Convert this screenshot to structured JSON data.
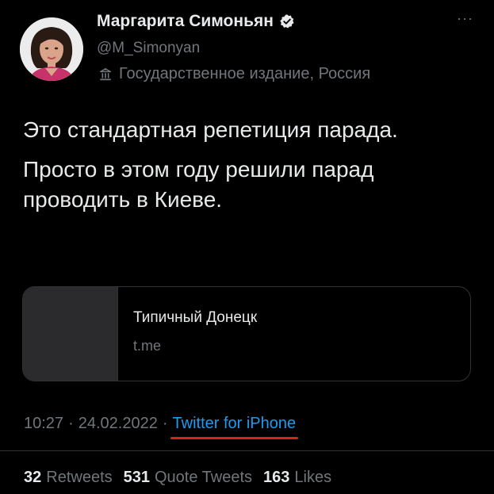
{
  "profile": {
    "display_name": "Маргарита Симоньян",
    "handle": "@M_Simonyan",
    "affiliation_label": "Государственное издание, Россия",
    "avatar_icon": "profile-photo",
    "verified_icon": "verified-badge-icon",
    "more_icon": "more-options-icon"
  },
  "tweet": {
    "paragraphs": [
      "Это стандартная репетиция парада.",
      "Просто в этом году решили парад проводить в Киеве."
    ]
  },
  "link_card": {
    "title": "Типичный Донецк",
    "domain": "t.me"
  },
  "meta": {
    "time": "10:27",
    "separator": "·",
    "date": "24.02.2022",
    "source": "Twitter for iPhone"
  },
  "stats": {
    "retweets_count": "32",
    "retweets_label": "Retweets",
    "quotes_count": "531",
    "quotes_label": "Quote Tweets",
    "likes_count": "163",
    "likes_label": "Likes"
  },
  "colors": {
    "background": "#000000",
    "primary_text": "#e7e9ea",
    "secondary_text": "#71767b",
    "link": "#1d9bf0",
    "annotation_underline": "#e0201c"
  }
}
